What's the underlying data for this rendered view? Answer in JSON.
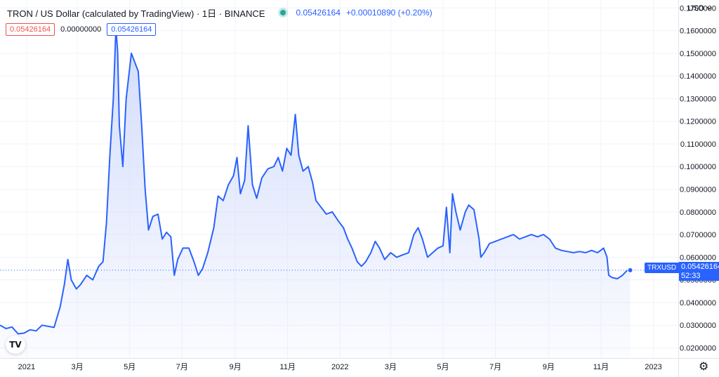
{
  "header": {
    "title": "TRON / US Dollar (calculated by TradingView) · 1日 · BINANCE",
    "price": "0.05426164",
    "change": "+0.00010890 (+0.20%)"
  },
  "values": {
    "open": "0.05426164",
    "volume": "0.00000000",
    "close": "0.05426164"
  },
  "currency": {
    "label": "USD",
    "dropdown_icon": "chevron-down-icon"
  },
  "price_tag": {
    "symbol": "TRXUSD",
    "price": "0.05426164",
    "countdown": "52:33"
  },
  "logo": {
    "text": "TV",
    "icon": "tradingview-logo-icon"
  },
  "settings": {
    "icon": "gear-icon"
  },
  "colors": {
    "line": "#2962ff",
    "fill_top": "#cdd8fb",
    "grid": "#f0f3fa",
    "up": "#26a69a",
    "down": "#ef5350"
  },
  "chart_data": {
    "type": "area",
    "title": "TRON / US Dollar",
    "x_start": "2020-12-01",
    "x_end": "2023-01-30",
    "ylim": [
      0.0155,
      0.1735
    ],
    "y_ticks": [
      0.02,
      0.03,
      0.04,
      0.05,
      0.06,
      0.07,
      0.08,
      0.09,
      0.1,
      0.11,
      0.12,
      0.13,
      0.14,
      0.15,
      0.16,
      0.17
    ],
    "y_tick_labels": [
      "0.0200000",
      "0.0300000",
      "0.0400000",
      "0.0500000",
      "0.0600000",
      "0.0700000",
      "0.0800000",
      "0.0900000",
      "0.1000000",
      "0.1100000",
      "0.1200000",
      "0.1300000",
      "0.1400000",
      "0.1500000",
      "0.1600000",
      "0.1700000"
    ],
    "x_ticks": [
      {
        "date": "2021-01-01",
        "label": "2021"
      },
      {
        "date": "2021-03-01",
        "label": "3月"
      },
      {
        "date": "2021-05-01",
        "label": "5月"
      },
      {
        "date": "2021-07-01",
        "label": "7月"
      },
      {
        "date": "2021-09-01",
        "label": "9月"
      },
      {
        "date": "2021-11-01",
        "label": "11月"
      },
      {
        "date": "2022-01-01",
        "label": "2022"
      },
      {
        "date": "2022-03-01",
        "label": "3月"
      },
      {
        "date": "2022-05-01",
        "label": "5月"
      },
      {
        "date": "2022-07-01",
        "label": "7月"
      },
      {
        "date": "2022-09-01",
        "label": "9月"
      },
      {
        "date": "2022-11-01",
        "label": "11月"
      },
      {
        "date": "2023-01-01",
        "label": "2023"
      }
    ],
    "last_price": 0.05426164,
    "grid": true,
    "series": [
      {
        "points": [
          [
            "2020-12-01",
            0.03
          ],
          [
            "2020-12-08",
            0.0285
          ],
          [
            "2020-12-15",
            0.0292
          ],
          [
            "2020-12-22",
            0.0262
          ],
          [
            "2020-12-29",
            0.0265
          ],
          [
            "2021-01-05",
            0.028
          ],
          [
            "2021-01-12",
            0.0275
          ],
          [
            "2021-01-19",
            0.03
          ],
          [
            "2021-01-26",
            0.0295
          ],
          [
            "2021-02-02",
            0.029
          ],
          [
            "2021-02-09",
            0.038
          ],
          [
            "2021-02-14",
            0.048
          ],
          [
            "2021-02-18",
            0.059
          ],
          [
            "2021-02-22",
            0.05
          ],
          [
            "2021-02-28",
            0.046
          ],
          [
            "2021-03-05",
            0.048
          ],
          [
            "2021-03-12",
            0.052
          ],
          [
            "2021-03-19",
            0.05
          ],
          [
            "2021-03-26",
            0.056
          ],
          [
            "2021-03-31",
            0.058
          ],
          [
            "2021-04-04",
            0.075
          ],
          [
            "2021-04-08",
            0.105
          ],
          [
            "2021-04-12",
            0.13
          ],
          [
            "2021-04-15",
            0.161
          ],
          [
            "2021-04-17",
            0.151
          ],
          [
            "2021-04-19",
            0.118
          ],
          [
            "2021-04-23",
            0.1
          ],
          [
            "2021-04-27",
            0.13
          ],
          [
            "2021-05-03",
            0.15
          ],
          [
            "2021-05-07",
            0.146
          ],
          [
            "2021-05-11",
            0.142
          ],
          [
            "2021-05-15",
            0.118
          ],
          [
            "2021-05-19",
            0.09
          ],
          [
            "2021-05-23",
            0.072
          ],
          [
            "2021-05-28",
            0.078
          ],
          [
            "2021-06-03",
            0.079
          ],
          [
            "2021-06-08",
            0.068
          ],
          [
            "2021-06-13",
            0.071
          ],
          [
            "2021-06-18",
            0.069
          ],
          [
            "2021-06-22",
            0.052
          ],
          [
            "2021-06-26",
            0.059
          ],
          [
            "2021-07-02",
            0.064
          ],
          [
            "2021-07-09",
            0.064
          ],
          [
            "2021-07-15",
            0.058
          ],
          [
            "2021-07-20",
            0.052
          ],
          [
            "2021-07-25",
            0.055
          ],
          [
            "2021-07-31",
            0.062
          ],
          [
            "2021-08-07",
            0.073
          ],
          [
            "2021-08-12",
            0.087
          ],
          [
            "2021-08-18",
            0.085
          ],
          [
            "2021-08-24",
            0.092
          ],
          [
            "2021-08-30",
            0.096
          ],
          [
            "2021-09-03",
            0.104
          ],
          [
            "2021-09-07",
            0.088
          ],
          [
            "2021-09-12",
            0.094
          ],
          [
            "2021-09-16",
            0.118
          ],
          [
            "2021-09-21",
            0.092
          ],
          [
            "2021-09-26",
            0.086
          ],
          [
            "2021-10-02",
            0.095
          ],
          [
            "2021-10-09",
            0.099
          ],
          [
            "2021-10-16",
            0.1
          ],
          [
            "2021-10-21",
            0.104
          ],
          [
            "2021-10-26",
            0.098
          ],
          [
            "2021-10-31",
            0.108
          ],
          [
            "2021-11-05",
            0.105
          ],
          [
            "2021-11-10",
            0.123
          ],
          [
            "2021-11-14",
            0.105
          ],
          [
            "2021-11-19",
            0.098
          ],
          [
            "2021-11-25",
            0.1
          ],
          [
            "2021-11-30",
            0.093
          ],
          [
            "2021-12-04",
            0.085
          ],
          [
            "2021-12-10",
            0.082
          ],
          [
            "2021-12-16",
            0.079
          ],
          [
            "2021-12-23",
            0.08
          ],
          [
            "2021-12-30",
            0.076
          ],
          [
            "2022-01-05",
            0.073
          ],
          [
            "2022-01-10",
            0.068
          ],
          [
            "2022-01-15",
            0.064
          ],
          [
            "2022-01-21",
            0.058
          ],
          [
            "2022-01-26",
            0.056
          ],
          [
            "2022-01-31",
            0.058
          ],
          [
            "2022-02-06",
            0.062
          ],
          [
            "2022-02-11",
            0.067
          ],
          [
            "2022-02-16",
            0.064
          ],
          [
            "2022-02-22",
            0.059
          ],
          [
            "2022-03-01",
            0.062
          ],
          [
            "2022-03-08",
            0.06
          ],
          [
            "2022-03-15",
            0.061
          ],
          [
            "2022-03-22",
            0.062
          ],
          [
            "2022-03-28",
            0.07
          ],
          [
            "2022-04-02",
            0.073
          ],
          [
            "2022-04-07",
            0.068
          ],
          [
            "2022-04-13",
            0.06
          ],
          [
            "2022-04-19",
            0.062
          ],
          [
            "2022-04-25",
            0.064
          ],
          [
            "2022-05-01",
            0.065
          ],
          [
            "2022-05-05",
            0.082
          ],
          [
            "2022-05-09",
            0.062
          ],
          [
            "2022-05-12",
            0.088
          ],
          [
            "2022-05-16",
            0.08
          ],
          [
            "2022-05-21",
            0.072
          ],
          [
            "2022-05-27",
            0.08
          ],
          [
            "2022-05-31",
            0.083
          ],
          [
            "2022-06-06",
            0.081
          ],
          [
            "2022-06-12",
            0.068
          ],
          [
            "2022-06-14",
            0.06
          ],
          [
            "2022-06-18",
            0.062
          ],
          [
            "2022-06-24",
            0.066
          ],
          [
            "2022-07-01",
            0.067
          ],
          [
            "2022-07-08",
            0.068
          ],
          [
            "2022-07-15",
            0.069
          ],
          [
            "2022-07-22",
            0.07
          ],
          [
            "2022-07-29",
            0.068
          ],
          [
            "2022-08-05",
            0.069
          ],
          [
            "2022-08-12",
            0.07
          ],
          [
            "2022-08-19",
            0.069
          ],
          [
            "2022-08-26",
            0.07
          ],
          [
            "2022-09-02",
            0.068
          ],
          [
            "2022-09-09",
            0.064
          ],
          [
            "2022-09-16",
            0.063
          ],
          [
            "2022-09-23",
            0.0625
          ],
          [
            "2022-09-30",
            0.062
          ],
          [
            "2022-10-07",
            0.0625
          ],
          [
            "2022-10-14",
            0.062
          ],
          [
            "2022-10-21",
            0.063
          ],
          [
            "2022-10-28",
            0.062
          ],
          [
            "2022-11-04",
            0.064
          ],
          [
            "2022-11-08",
            0.06
          ],
          [
            "2022-11-10",
            0.052
          ],
          [
            "2022-11-14",
            0.051
          ],
          [
            "2022-11-20",
            0.0505
          ],
          [
            "2022-11-26",
            0.052
          ],
          [
            "2022-12-01",
            0.054
          ],
          [
            "2022-12-05",
            0.05426164
          ]
        ]
      }
    ]
  }
}
